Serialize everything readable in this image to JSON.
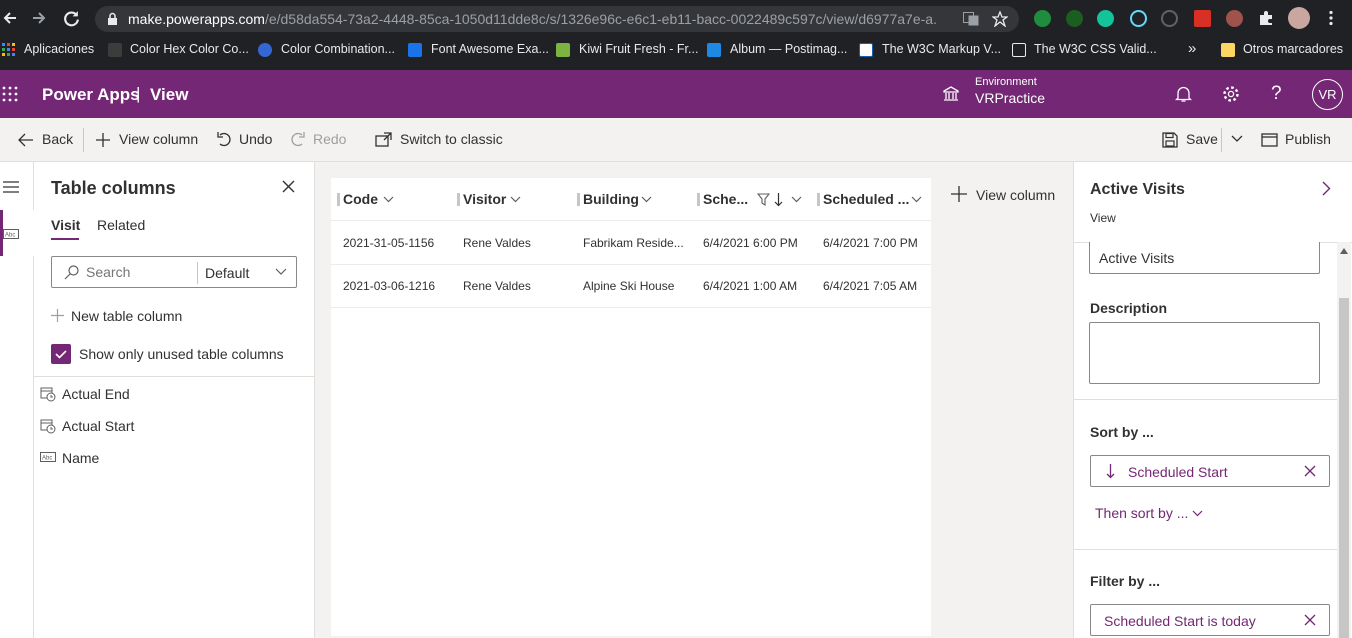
{
  "browser": {
    "url_host": "make.powerapps.com",
    "url_path": "/e/d58da554-73a2-4448-85ca-1050d11dde8c/s/1326e96c-e6c1-eb11-bacc-0022489c597c/view/d6977a7e-a...",
    "bookmarks": [
      {
        "label": "Aplicaciones"
      },
      {
        "label": "Color Hex Color Co..."
      },
      {
        "label": "Color Combination..."
      },
      {
        "label": "Font Awesome Exa..."
      },
      {
        "label": "Kiwi Fruit Fresh - Fr..."
      },
      {
        "label": "Album — Postimag..."
      },
      {
        "label": "The W3C Markup V..."
      },
      {
        "label": "The W3C CSS Valid..."
      }
    ],
    "more_bookmarks": "»",
    "other_bookmarks": "Otros marcadores"
  },
  "header": {
    "app_name": "Power Apps",
    "separator": "|",
    "page": "View",
    "env_label": "Environment",
    "env_name": "VRPractice",
    "avatar": "VR"
  },
  "command_bar": {
    "back": "Back",
    "view_column": "View column",
    "undo": "Undo",
    "redo": "Redo",
    "switch_classic": "Switch to classic",
    "save": "Save",
    "publish": "Publish"
  },
  "table_columns": {
    "title": "Table columns",
    "tabs": [
      "Visit",
      "Related"
    ],
    "search_placeholder": "Search",
    "filter_value": "Default",
    "new_column": "New table column",
    "show_unused": "Show only unused table columns",
    "columns": [
      "Actual End",
      "Actual Start",
      "Name"
    ]
  },
  "grid": {
    "headers": [
      "Code",
      "Visitor",
      "Building",
      "Sche...",
      "Scheduled ..."
    ],
    "rows": [
      [
        "2021-31-05-1156",
        "Rene Valdes",
        "Fabrikam Reside...",
        "6/4/2021 6:00 PM",
        "6/4/2021 7:00 PM"
      ],
      [
        "2021-03-06-1216",
        "Rene Valdes",
        "Alpine Ski House",
        "6/4/2021 1:00 AM",
        "6/4/2021 7:05 AM"
      ]
    ],
    "add_column": "View column"
  },
  "properties": {
    "title": "Active Visits",
    "subtitle": "View",
    "name_value": "Active Visits",
    "description_label": "Description",
    "description_value": "",
    "sort_label": "Sort by ...",
    "sort_value": "Scheduled Start",
    "then_sort": "Then sort by ...",
    "filter_label": "Filter by ...",
    "filter_value": "Scheduled Start is today"
  },
  "colors": {
    "brand": "#742774",
    "checkbox": "#742774",
    "pill_border": "#8a8886"
  }
}
